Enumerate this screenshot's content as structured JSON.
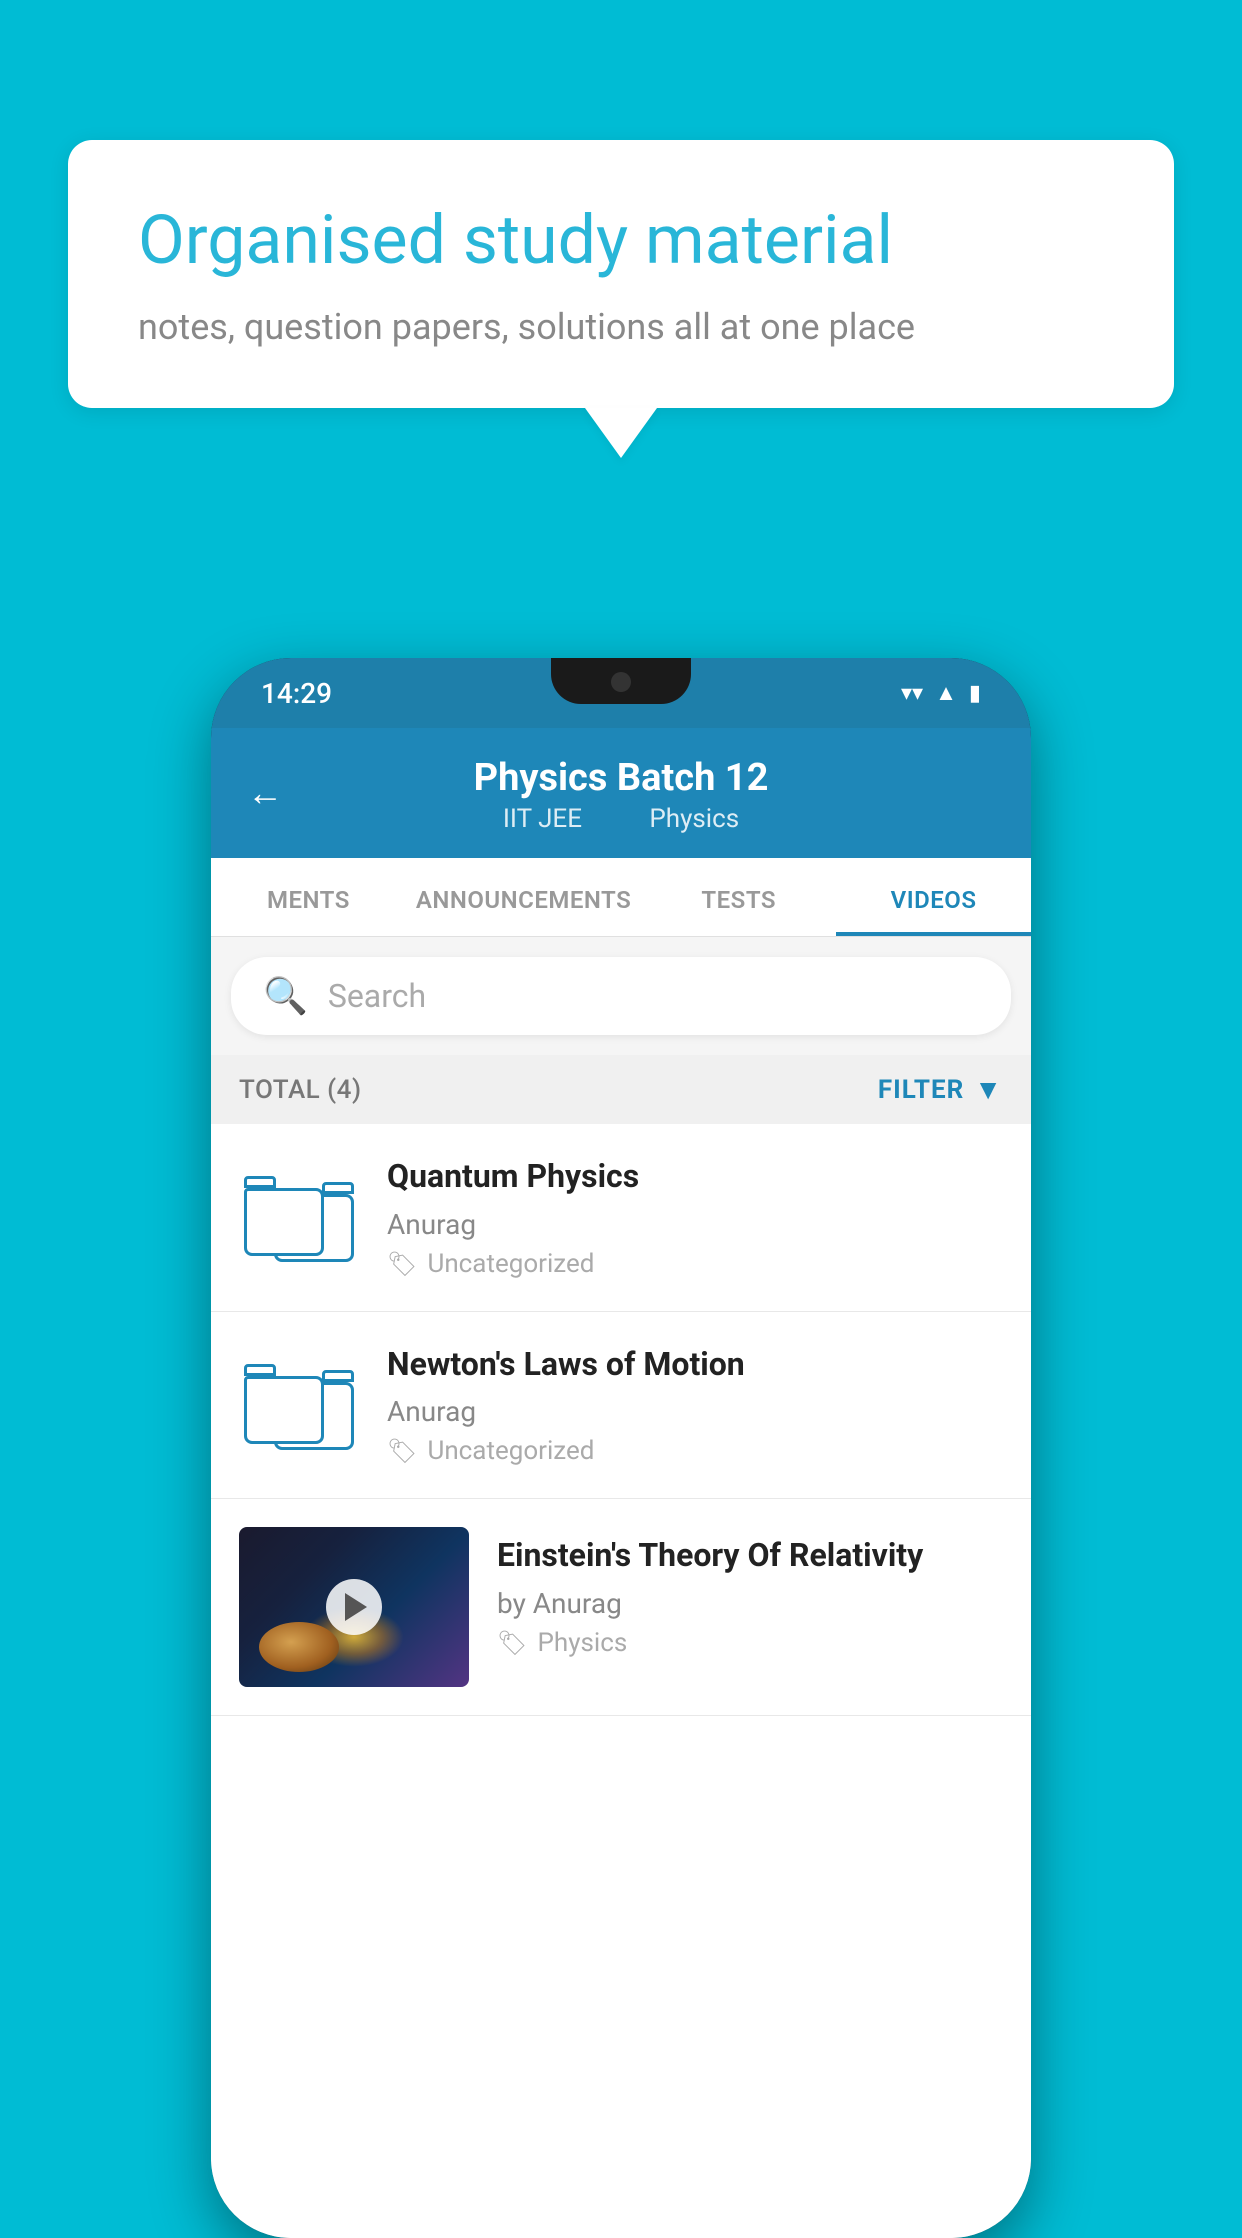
{
  "background": {
    "color": "#00bcd4"
  },
  "speech_bubble": {
    "title": "Organised study material",
    "subtitle": "notes, question papers, solutions all at one place"
  },
  "phone": {
    "status_bar": {
      "time": "14:29"
    },
    "header": {
      "back_label": "←",
      "title": "Physics Batch 12",
      "subtitle_part1": "IIT JEE",
      "subtitle_part2": "Physics"
    },
    "tabs": [
      {
        "label": "MENTS",
        "active": false
      },
      {
        "label": "ANNOUNCEMENTS",
        "active": false
      },
      {
        "label": "TESTS",
        "active": false
      },
      {
        "label": "VIDEOS",
        "active": true
      }
    ],
    "search": {
      "placeholder": "Search"
    },
    "filter_bar": {
      "total_label": "TOTAL (4)",
      "filter_label": "FILTER"
    },
    "videos": [
      {
        "id": "quantum",
        "title": "Quantum Physics",
        "author": "Anurag",
        "tag": "Uncategorized",
        "has_thumbnail": false
      },
      {
        "id": "newton",
        "title": "Newton's Laws of Motion",
        "author": "Anurag",
        "tag": "Uncategorized",
        "has_thumbnail": false
      },
      {
        "id": "einstein",
        "title": "Einstein's Theory Of Relativity",
        "author": "by Anurag",
        "tag": "Physics",
        "has_thumbnail": true
      }
    ]
  }
}
